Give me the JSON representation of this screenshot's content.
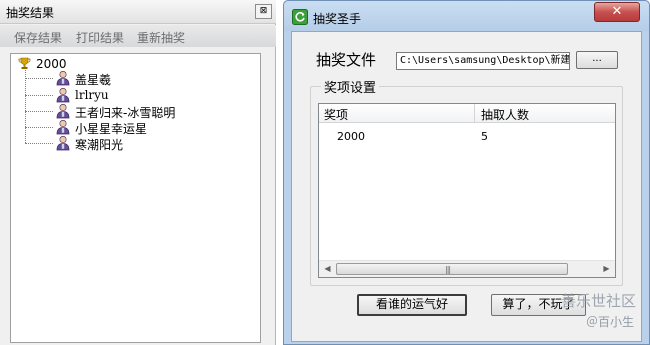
{
  "left_window": {
    "title": "抽奖结果",
    "close_glyph": "⊠",
    "menu": [
      "保存结果",
      "打印结果",
      "重新抽奖"
    ],
    "tree": {
      "root_label": "2000",
      "root_icon": "trophy-icon",
      "children": [
        {
          "label": "盖星羲",
          "icon": "person-icon"
        },
        {
          "label": "lrlryu",
          "icon": "person-icon"
        },
        {
          "label": "王者归来-冰雪聪明",
          "icon": "person-icon"
        },
        {
          "label": "小星星幸运星",
          "icon": "person-icon"
        },
        {
          "label": "寒潮阳光",
          "icon": "person-icon"
        }
      ]
    }
  },
  "dialog": {
    "title": "抽奖圣手",
    "close_glyph": "✕",
    "file_label": "抽奖文件",
    "file_path": "C:\\Users\\samsung\\Desktop\\新建",
    "browse_label": "...",
    "group_label": "奖项设置",
    "list_columns": [
      "奖项",
      "抽取人数"
    ],
    "list_rows": [
      {
        "prize": "2000",
        "count": "5"
      }
    ],
    "scroll": {
      "left": "◀",
      "right": "▶",
      "grip": "|||"
    },
    "luck_button": "看谁的运气好",
    "quit_button": "算了，不玩了"
  },
  "watermark": {
    "line1": "善乐世社区",
    "line2": "＠百小生"
  },
  "colors": {
    "dialog_frame": "#b9d1ea",
    "close_red": "#c75050",
    "app_icon_green": "#3aa03a"
  }
}
